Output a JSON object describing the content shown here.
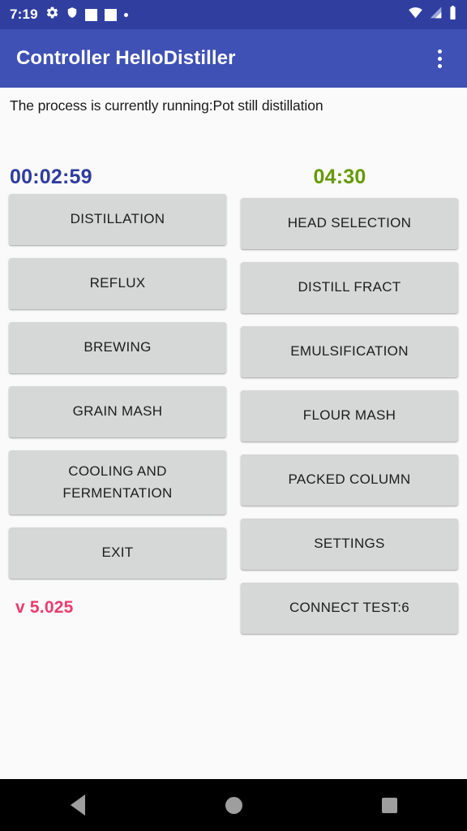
{
  "status_bar": {
    "time": "7:19",
    "left_icons": [
      "gear-icon",
      "shield-icon",
      "square-icon",
      "square-icon",
      "dot-icon"
    ],
    "right_icons": [
      "wifi-icon",
      "cellular-signal-icon",
      "battery-icon"
    ],
    "background_color": "#303f9f"
  },
  "app_bar": {
    "title": "Controller HelloDistiller",
    "overflow_icon": "more-vertical-icon",
    "background_color": "#3f51b5",
    "title_color": "#ffffff"
  },
  "main": {
    "status_message": "The process is currently running:Pot still distillation",
    "timers": {
      "elapsed": "00:02:59",
      "elapsed_color": "#2f3c9e",
      "remaining": "04:30",
      "remaining_color": "#669900"
    },
    "left_buttons": [
      {
        "label": "DISTILLATION",
        "multiline": false
      },
      {
        "label": "REFLUX",
        "multiline": false
      },
      {
        "label": "BREWING",
        "multiline": false
      },
      {
        "label": "GRAIN MASH",
        "multiline": false
      },
      {
        "label": "COOLING AND\nFERMENTATION",
        "multiline": true
      },
      {
        "label": "EXIT",
        "multiline": false
      }
    ],
    "right_buttons": [
      {
        "label": "HEAD SELECTION",
        "multiline": false
      },
      {
        "label": "DISTILL FRACT",
        "multiline": false
      },
      {
        "label": "EMULSIFICATION",
        "multiline": false
      },
      {
        "label": "FLOUR MASH",
        "multiline": false
      },
      {
        "label": "PACKED COLUMN",
        "multiline": false
      },
      {
        "label": "SETTINGS",
        "multiline": false
      },
      {
        "label": "CONNECT TEST:6",
        "multiline": false
      }
    ],
    "version": "v 5.025",
    "version_color": "#ec3b6e",
    "button_color": "#d6d7d7",
    "background_color": "#fafafa"
  },
  "nav_bar": {
    "back_icon": "back-triangle-icon",
    "home_icon": "home-circle-icon",
    "recents_icon": "recents-square-icon",
    "background_color": "#000000"
  }
}
